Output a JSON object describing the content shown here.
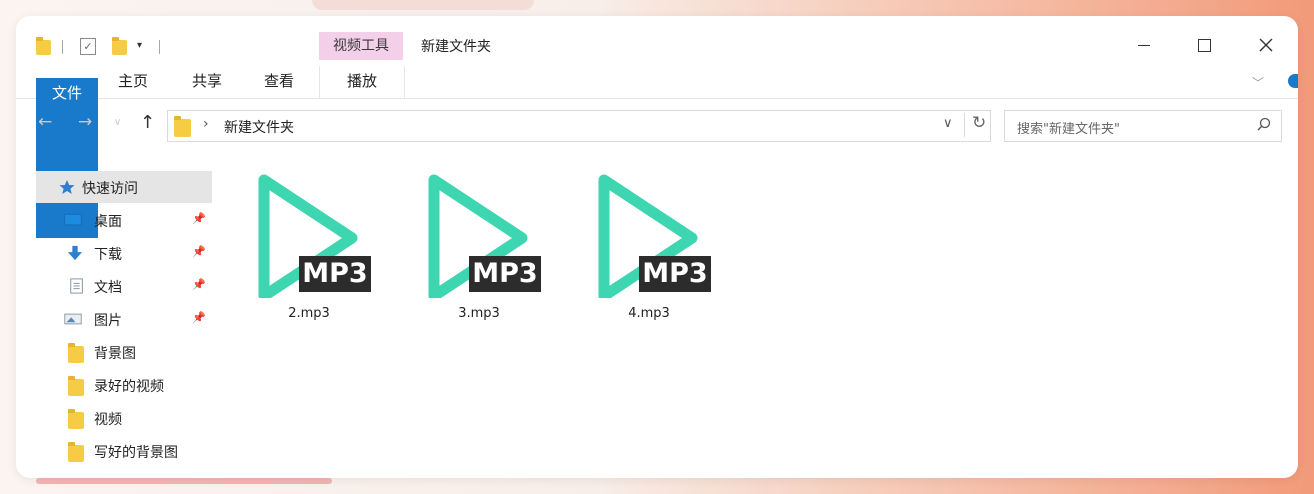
{
  "window": {
    "title": "新建文件夹",
    "context_tab": "视频工具",
    "controls": {
      "minimize": "—",
      "maximize": "☐",
      "close": "✕"
    }
  },
  "ribbon": {
    "tabs": [
      "文件",
      "主页",
      "共享",
      "查看",
      "播放"
    ]
  },
  "address": {
    "path": "新建文件夹",
    "search_placeholder": "搜索\"新建文件夹\""
  },
  "sidebar": {
    "items": [
      {
        "label": "快速访问",
        "icon": "star-icon"
      },
      {
        "label": "桌面",
        "icon": "desktop-icon"
      },
      {
        "label": "下载",
        "icon": "download-icon"
      },
      {
        "label": "文档",
        "icon": "document-icon"
      },
      {
        "label": "图片",
        "icon": "picture-icon"
      },
      {
        "label": "背景图",
        "icon": "folder-icon"
      },
      {
        "label": "录好的视频",
        "icon": "folder-icon"
      },
      {
        "label": "视频",
        "icon": "folder-icon"
      },
      {
        "label": "写好的背景图",
        "icon": "folder-icon"
      }
    ]
  },
  "files": [
    {
      "name": "2.mp3",
      "badge": "MP3"
    },
    {
      "name": "3.mp3",
      "badge": "MP3"
    },
    {
      "name": "4.mp3",
      "badge": "MP3"
    }
  ],
  "colors": {
    "accent": "#1979ca",
    "play_icon": "#3dd6b0",
    "context_tab": "#f3cfe9",
    "folder": "#f7cc45"
  }
}
